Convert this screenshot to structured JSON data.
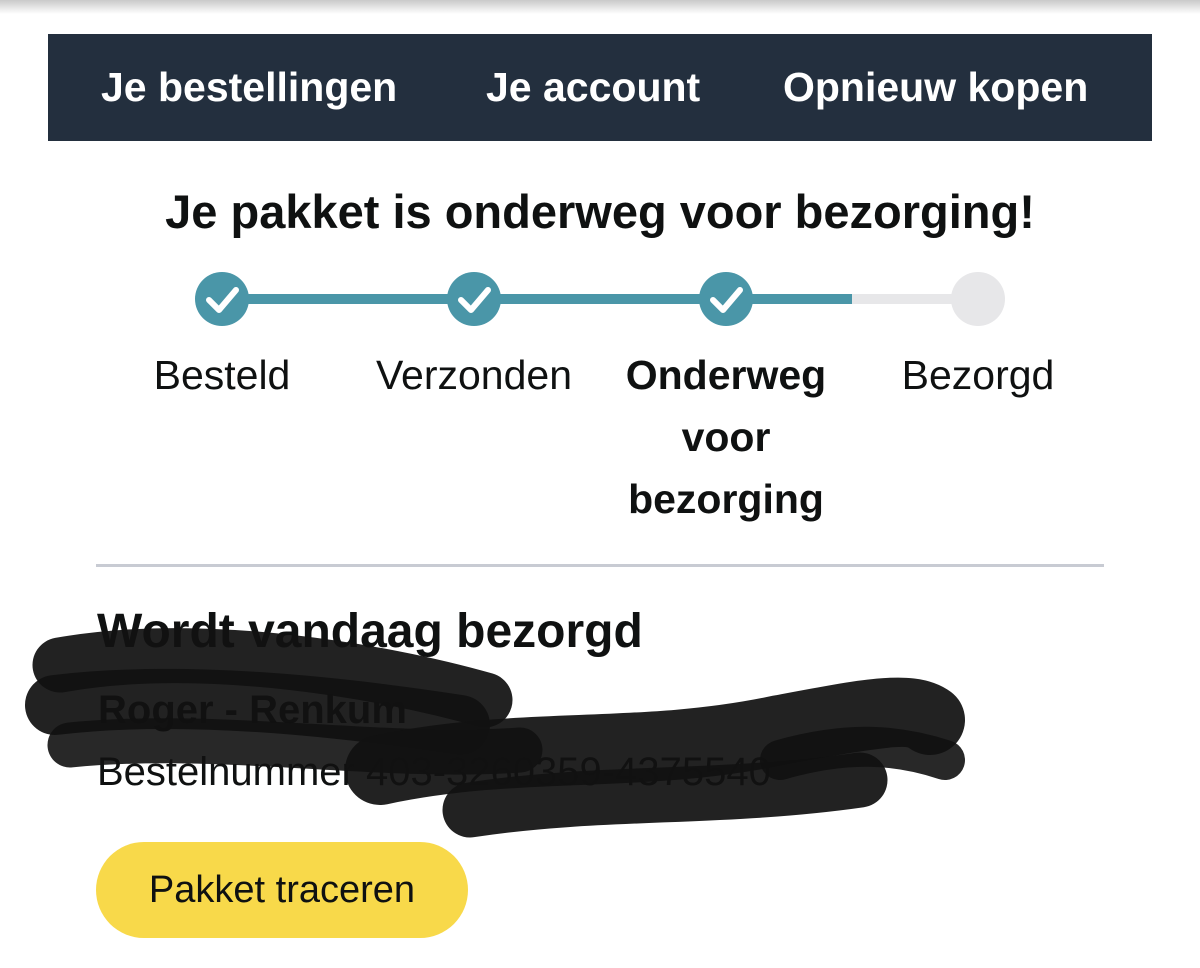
{
  "nav": {
    "items": [
      {
        "label": "Je bestellingen"
      },
      {
        "label": "Je account"
      },
      {
        "label": "Opnieuw kopen"
      }
    ]
  },
  "status": {
    "headline": "Je pakket is onderweg voor bezorging!",
    "steps": [
      {
        "label": "Besteld",
        "done": true,
        "current": false
      },
      {
        "label": "Verzonden",
        "done": true,
        "current": false
      },
      {
        "label": "Onderweg voor bezorging",
        "done": true,
        "current": true
      },
      {
        "label": "Bezorgd",
        "done": false,
        "current": false
      }
    ]
  },
  "delivery": {
    "title": "Wordt vandaag bezorgd",
    "recipient": "Roger - Renkum",
    "order_label": "Bestelnummer 403-3260359-4375540",
    "track_button_label": "Pakket traceren"
  },
  "colors": {
    "nav_background": "#232f3e",
    "progress_done": "#4a96a8",
    "progress_pending": "#e7e7e9",
    "button": "#f8d94a"
  },
  "icons": [
    "check-icon"
  ]
}
